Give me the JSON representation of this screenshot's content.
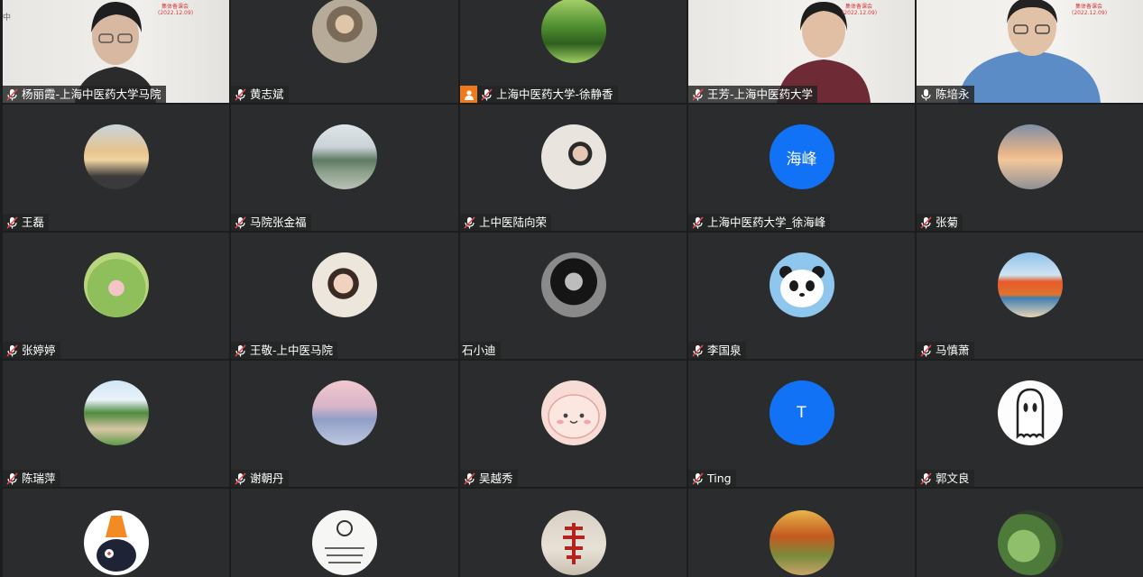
{
  "participants": [
    {
      "name": "杨丽霞-上海中医药大学马院",
      "mic": "muted",
      "type": "video"
    },
    {
      "name": "黄志斌",
      "mic": "muted",
      "type": "photo"
    },
    {
      "name": "上海中医药大学-徐静香",
      "mic": "muted",
      "type": "photo",
      "sharing": true
    },
    {
      "name": "王芳-上海中医药大学",
      "mic": "muted",
      "type": "video"
    },
    {
      "name": "陈培永",
      "mic": "on",
      "type": "video"
    },
    {
      "name": "王磊",
      "mic": "muted",
      "type": "photo"
    },
    {
      "name": "马院张金福",
      "mic": "muted",
      "type": "photo"
    },
    {
      "name": "上中医陆向荣",
      "mic": "muted",
      "type": "photo"
    },
    {
      "name": "上海中医药大学_徐海峰",
      "mic": "muted",
      "type": "text",
      "avatar_text": "海峰"
    },
    {
      "name": "张菊",
      "mic": "muted",
      "type": "photo"
    },
    {
      "name": "张婷婷",
      "mic": "muted",
      "type": "photo"
    },
    {
      "name": "王敬-上中医马院",
      "mic": "muted",
      "type": "photo"
    },
    {
      "name": "石小迪",
      "mic": "none",
      "type": "photo"
    },
    {
      "name": "李国泉",
      "mic": "muted",
      "type": "photo"
    },
    {
      "name": "马慎萧",
      "mic": "muted",
      "type": "photo"
    },
    {
      "name": "陈瑞萍",
      "mic": "muted",
      "type": "photo"
    },
    {
      "name": "谢朝丹",
      "mic": "muted",
      "type": "photo"
    },
    {
      "name": "吴越秀",
      "mic": "muted",
      "type": "photo"
    },
    {
      "name": "Ting",
      "mic": "muted",
      "type": "text",
      "avatar_text": "T"
    },
    {
      "name": "郭文良",
      "mic": "muted",
      "type": "photo"
    }
  ],
  "video_overlay": {
    "banner_title": "集体备课会",
    "banner_date": "(2022.12.09)",
    "edge_text": "中"
  },
  "colors": {
    "background": "#1c1d1f",
    "tile": "#2b2c2e",
    "text_avatar": "#1172f5",
    "share_badge": "#f07a1b",
    "muted_icon": "#e5484d"
  }
}
